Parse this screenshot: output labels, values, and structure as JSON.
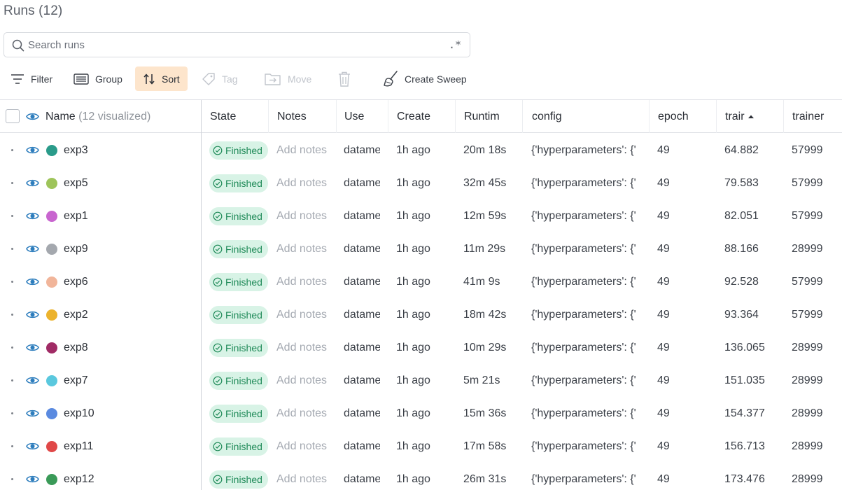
{
  "page": {
    "title": "Runs (12)"
  },
  "search": {
    "placeholder": "Search runs",
    "value": "",
    "regex_label": ".*"
  },
  "toolbar": {
    "filter": "Filter",
    "group": "Group",
    "sort": "Sort",
    "tag": "Tag",
    "move": "Move",
    "create_sweep": "Create Sweep"
  },
  "table": {
    "headers": {
      "name": "Name",
      "name_suffix": "(12 visualized)",
      "state": "State",
      "notes": "Notes",
      "user": "Use",
      "created": "Create",
      "runtime": "Runtim",
      "config": "config",
      "epoch": "epoch",
      "train": "trair",
      "trainer": "trainer"
    },
    "rows": [
      {
        "name": "exp3",
        "color": "#2a9b8a",
        "state": "Finished",
        "notes": "Add notes",
        "user": "datame",
        "created": "1h ago",
        "runtime": "20m 18s",
        "config": "{'hyperparameters': {'",
        "epoch": "49",
        "train": "64.882",
        "trainer": "57999"
      },
      {
        "name": "exp5",
        "color": "#9ec45a",
        "state": "Finished",
        "notes": "Add notes",
        "user": "datame",
        "created": "1h ago",
        "runtime": "32m 45s",
        "config": "{'hyperparameters': {'",
        "epoch": "49",
        "train": "79.583",
        "trainer": "57999"
      },
      {
        "name": "exp1",
        "color": "#c865cf",
        "state": "Finished",
        "notes": "Add notes",
        "user": "datame",
        "created": "1h ago",
        "runtime": "12m 59s",
        "config": "{'hyperparameters': {'",
        "epoch": "49",
        "train": "82.051",
        "trainer": "57999"
      },
      {
        "name": "exp9",
        "color": "#a4a8ae",
        "state": "Finished",
        "notes": "Add notes",
        "user": "datame",
        "created": "1h ago",
        "runtime": "11m 29s",
        "config": "{'hyperparameters': {'",
        "epoch": "49",
        "train": "88.166",
        "trainer": "28999"
      },
      {
        "name": "exp6",
        "color": "#f1b59a",
        "state": "Finished",
        "notes": "Add notes",
        "user": "datame",
        "created": "1h ago",
        "runtime": "41m 9s",
        "config": "{'hyperparameters': {'",
        "epoch": "49",
        "train": "92.528",
        "trainer": "57999"
      },
      {
        "name": "exp2",
        "color": "#ecb32d",
        "state": "Finished",
        "notes": "Add notes",
        "user": "datame",
        "created": "1h ago",
        "runtime": "18m 42s",
        "config": "{'hyperparameters': {'",
        "epoch": "49",
        "train": "93.364",
        "trainer": "57999"
      },
      {
        "name": "exp8",
        "color": "#a02b65",
        "state": "Finished",
        "notes": "Add notes",
        "user": "datame",
        "created": "1h ago",
        "runtime": "10m 29s",
        "config": "{'hyperparameters': {'",
        "epoch": "49",
        "train": "136.065",
        "trainer": "28999"
      },
      {
        "name": "exp7",
        "color": "#5ac8de",
        "state": "Finished",
        "notes": "Add notes",
        "user": "datame",
        "created": "1h ago",
        "runtime": "5m 21s",
        "config": "{'hyperparameters': {'",
        "epoch": "49",
        "train": "151.035",
        "trainer": "28999"
      },
      {
        "name": "exp10",
        "color": "#5a8ae0",
        "state": "Finished",
        "notes": "Add notes",
        "user": "datame",
        "created": "1h ago",
        "runtime": "15m 36s",
        "config": "{'hyperparameters': {'",
        "epoch": "49",
        "train": "154.377",
        "trainer": "28999"
      },
      {
        "name": "exp11",
        "color": "#e04848",
        "state": "Finished",
        "notes": "Add notes",
        "user": "datame",
        "created": "1h ago",
        "runtime": "17m 58s",
        "config": "{'hyperparameters': {'",
        "epoch": "49",
        "train": "156.713",
        "trainer": "28999"
      },
      {
        "name": "exp12",
        "color": "#3a9a58",
        "state": "Finished",
        "notes": "Add notes",
        "user": "datame",
        "created": "1h ago",
        "runtime": "26m 31s",
        "config": "{'hyperparameters': {'",
        "epoch": "49",
        "train": "173.476",
        "trainer": "28999"
      }
    ]
  },
  "icons": {
    "search": "search-icon",
    "filter": "filter-icon",
    "group": "group-icon",
    "sort": "sort-icon",
    "tag": "tag-icon",
    "move": "move-icon",
    "delete": "trash-icon",
    "sweep": "broom-icon",
    "visibility": "eye-icon",
    "state": "check-circle-icon"
  }
}
